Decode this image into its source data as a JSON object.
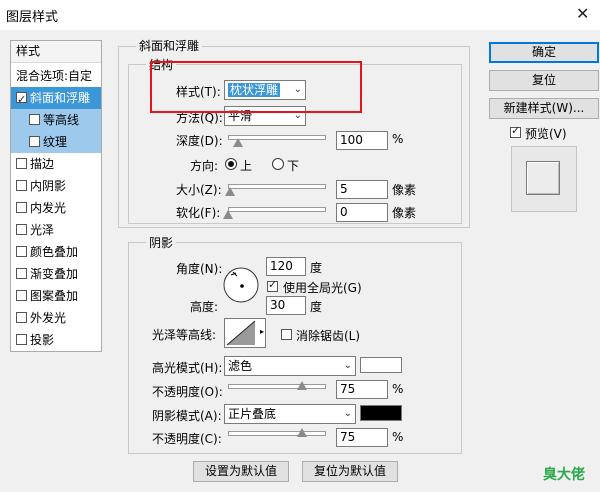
{
  "window": {
    "title": "图层样式",
    "close_glyph": "✕"
  },
  "style_list": {
    "header": "样式",
    "items": [
      {
        "label": "混合选项:自定",
        "checkbox": false,
        "checked": false
      },
      {
        "label": "斜面和浮雕",
        "checkbox": true,
        "checked": true
      },
      {
        "label": "等高线",
        "checkbox": true,
        "checked": false
      },
      {
        "label": "纹理",
        "checkbox": true,
        "checked": false
      },
      {
        "label": "描边",
        "checkbox": true,
        "checked": false
      },
      {
        "label": "内阴影",
        "checkbox": true,
        "checked": false
      },
      {
        "label": "内发光",
        "checkbox": true,
        "checked": false
      },
      {
        "label": "光泽",
        "checkbox": true,
        "checked": false
      },
      {
        "label": "颜色叠加",
        "checkbox": true,
        "checked": false
      },
      {
        "label": "渐变叠加",
        "checkbox": true,
        "checked": false
      },
      {
        "label": "图案叠加",
        "checkbox": true,
        "checked": false
      },
      {
        "label": "外发光",
        "checkbox": true,
        "checked": false
      },
      {
        "label": "投影",
        "checkbox": true,
        "checked": false
      }
    ]
  },
  "bevel": {
    "group_title": "斜面和浮雕",
    "structure_title": "结构",
    "style_label": "样式(T):",
    "style_value": "枕状浮雕",
    "technique_label": "方法(Q):",
    "technique_value": "平滑",
    "depth_label": "深度(D):",
    "depth_value": "100",
    "depth_unit": "%",
    "depth_fraction": 0.1,
    "direction_label": "方向:",
    "direction_up": "上",
    "direction_down": "下",
    "size_label": "大小(Z):",
    "size_value": "5",
    "size_unit": "像素",
    "size_fraction": 0.02,
    "soften_label": "软化(F):",
    "soften_value": "0",
    "soften_unit": "像素",
    "soften_fraction": 0.0
  },
  "shading": {
    "group_title": "阴影",
    "angle_label": "角度(N):",
    "angle_value": "120",
    "angle_unit": "度",
    "global_light_label": "使用全局光(G)",
    "global_light_checked": true,
    "altitude_label": "高度:",
    "altitude_value": "30",
    "altitude_unit": "度",
    "gloss_label": "光泽等高线:",
    "antialias_label": "消除锯齿(L)",
    "highlight_mode_label": "高光模式(H):",
    "highlight_mode_value": "滤色",
    "highlight_color": "#ffffff",
    "highlight_opacity_label": "不透明度(O):",
    "highlight_opacity_value": "75",
    "highlight_opacity_fraction": 0.75,
    "shadow_mode_label": "阴影模式(A):",
    "shadow_mode_value": "正片叠底",
    "shadow_color": "#000000",
    "shadow_opacity_label": "不透明度(C):",
    "shadow_opacity_value": "75",
    "shadow_opacity_fraction": 0.75,
    "percent": "%"
  },
  "footer": {
    "make_default": "设置为默认值",
    "reset_default": "复位为默认值"
  },
  "right_panel": {
    "ok": "确定",
    "reset": "复位",
    "new_style": "新建样式(W)...",
    "preview_label": "预览(V)",
    "preview_checked": true
  },
  "watermark": "臭大佬",
  "colors": {
    "selection": "#3c97d8",
    "annotation": "#e8141c",
    "watermark": "#2aa84a"
  }
}
